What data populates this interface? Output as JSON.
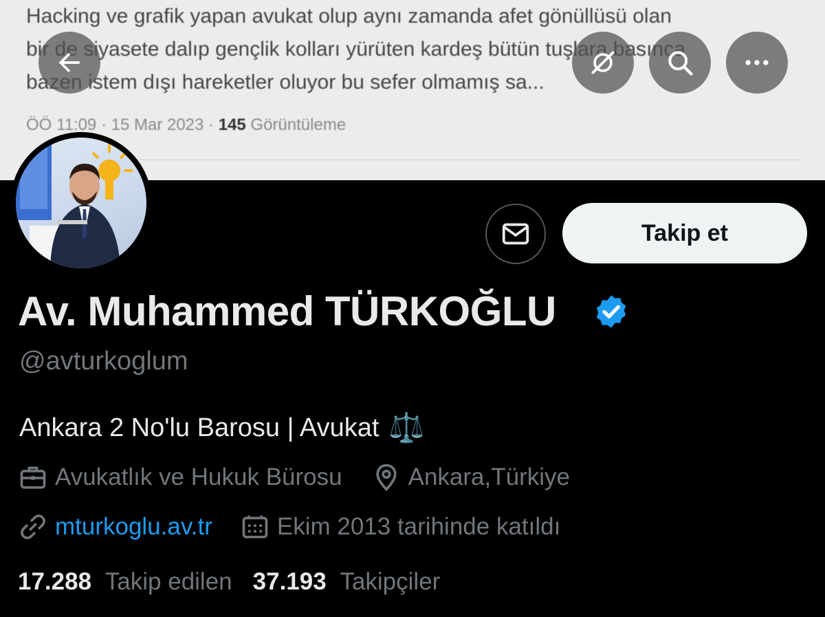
{
  "banner": {
    "tweet_lines": [
      "Hacking ve grafik yapan avukat olup aynı zamanda afet gönüllüsü olan",
      "bir de siyasete dalıp gençlik kolları yürüten kardeş bütün tuşlara basınca",
      "bazen istem dışı hareketler oluyor bu sefer olmamış sa..."
    ],
    "time": "ÖÖ 11:09 · 15 Mar 2023 · ",
    "views_count": "145",
    "views_label": "Görüntüleme"
  },
  "nav": {
    "back_icon": "arrow-left-icon",
    "grok_icon": "grok-icon",
    "search_icon": "search-icon",
    "more_icon": "more-icon"
  },
  "actions": {
    "message_icon": "envelope-icon",
    "follow_label": "Takip et"
  },
  "profile": {
    "name": "Av. Muhammed TÜRKOĞLU",
    "handle": "@avturkoglum",
    "bio": "Ankara 2 No'lu Barosu | Avukat",
    "bio_emoji": "⚖️",
    "category": "Avukatlık ve Hukuk Bürosu",
    "location": "Ankara,Türkiye",
    "website": "mturkoglu.av.tr",
    "joined": "Ekim 2013 tarihinde katıldı",
    "following_count": "17.288",
    "following_label": "Takip edilen",
    "followers_count": "37.193",
    "followers_label": "Takipçiler"
  },
  "colors": {
    "background": "#000000",
    "accent": "#1d9bf0",
    "text_primary": "#e7e9ea",
    "text_secondary": "#71767b"
  }
}
